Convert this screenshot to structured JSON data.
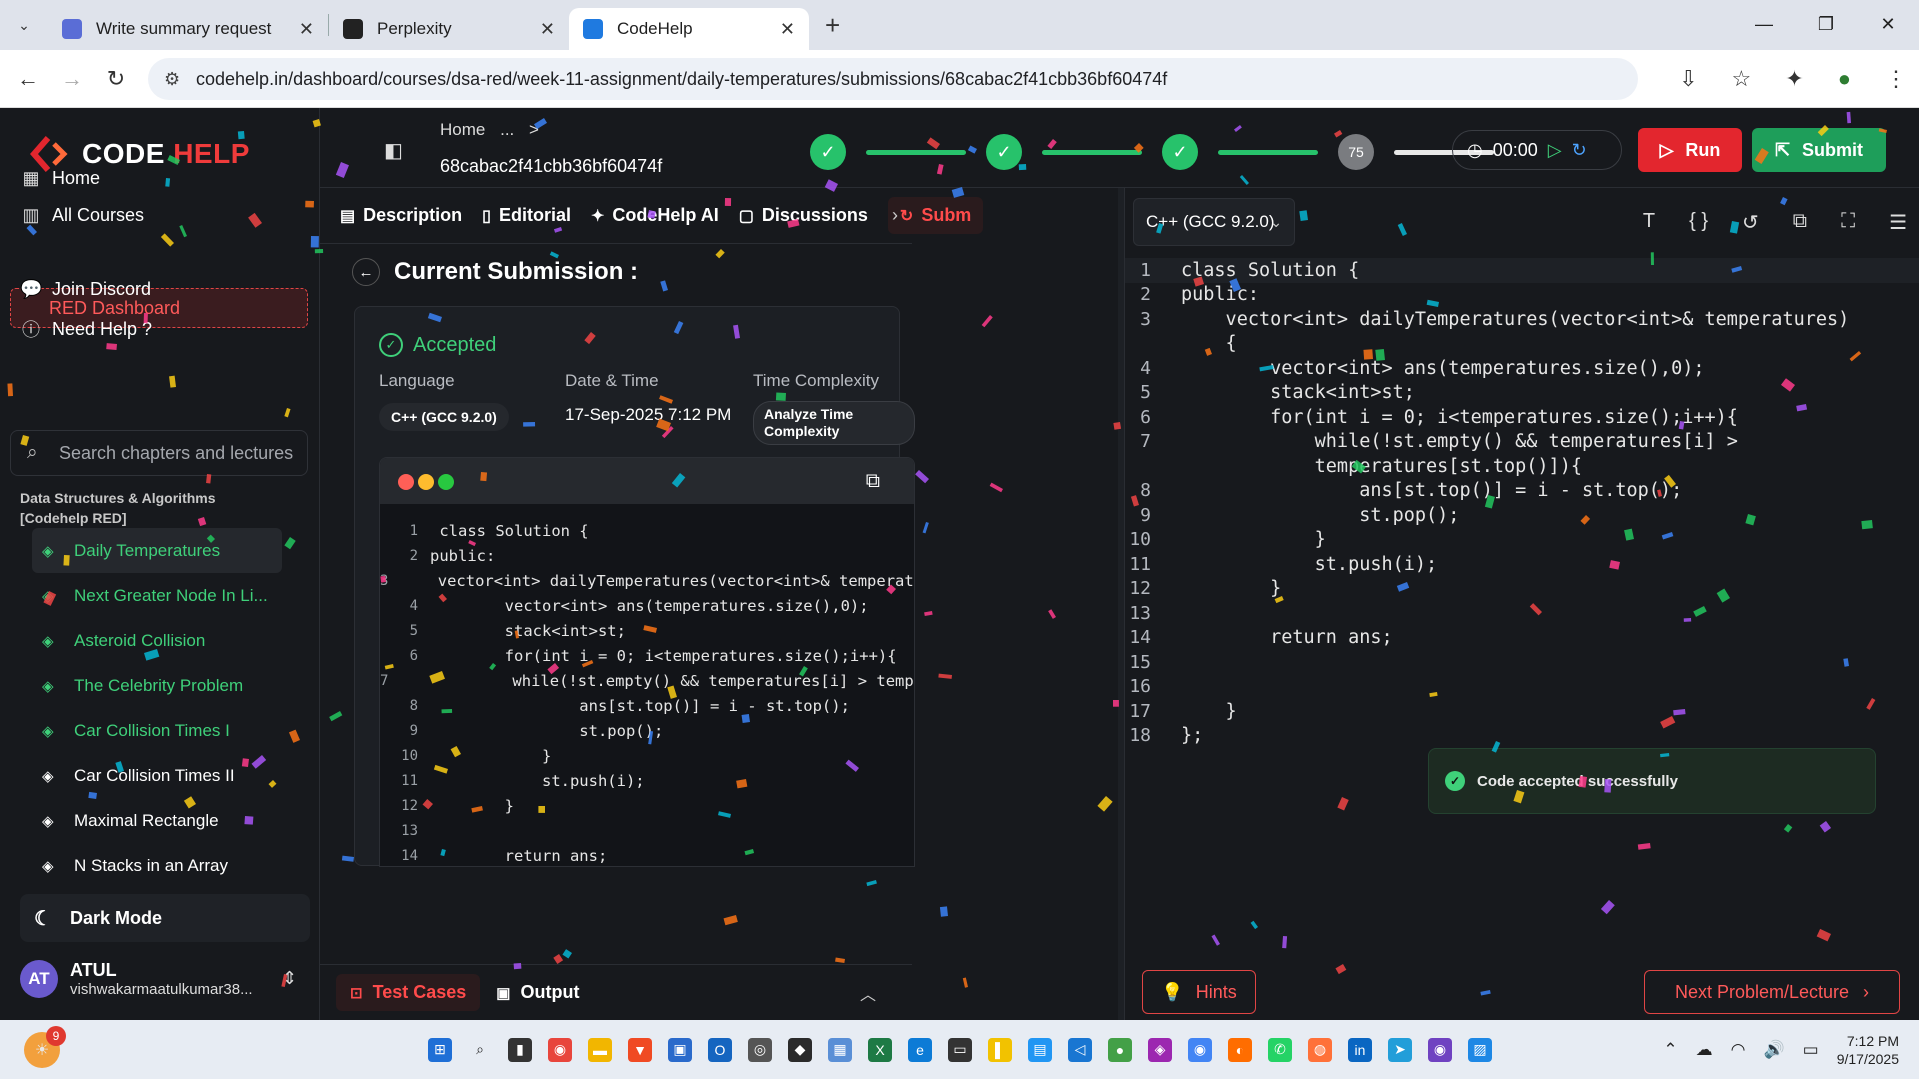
{
  "browser": {
    "tabs": [
      {
        "title": "Write summary request",
        "fav_color": "#5a6dd6"
      },
      {
        "title": "Perplexity",
        "fav_color": "#222222"
      },
      {
        "title": "CodeHelp",
        "fav_color": "#1f7ae0"
      }
    ],
    "url": "codehelp.in/dashboard/courses/dsa-red/week-11-assignment/daily-temperatures/submissions/68cabac2f41cbb36bf60474f"
  },
  "sidebar": {
    "logo_code": "CODE",
    "logo_help": "HELP",
    "nav": [
      {
        "label": "Home",
        "icon": "grid-icon"
      },
      {
        "label": "All Courses",
        "icon": "library-icon"
      },
      {
        "label": "RED Dashboard",
        "icon": "dashboard-icon"
      },
      {
        "label": "Join Discord",
        "icon": "chat-icon"
      },
      {
        "label": "Need Help ?",
        "icon": "help-icon"
      }
    ],
    "search_placeholder": "Search chapters and lectures",
    "course_title": "Data Structures & Algorithms [Codehelp RED]",
    "lessons": [
      {
        "label": "Daily Temperatures",
        "done": true,
        "selected": true
      },
      {
        "label": "Next Greater Node In Li...",
        "done": true
      },
      {
        "label": "Asteroid Collision",
        "done": true
      },
      {
        "label": "The Celebrity Problem",
        "done": true
      },
      {
        "label": "Car Collision Times I",
        "done": true
      },
      {
        "label": "Car Collision Times II",
        "done": false
      },
      {
        "label": "Maximal Rectangle",
        "done": false
      },
      {
        "label": "N Stacks in an Array",
        "done": false
      }
    ],
    "dark_mode_label": "Dark Mode",
    "user": {
      "initials": "AT",
      "name": "ATUL",
      "email": "vishwakarmaatulkumar38..."
    }
  },
  "topbar": {
    "breadcrumb_home": "Home",
    "breadcrumb_more": "...",
    "breadcrumb_sep": ">",
    "submission_id": "68cabac2f41cbb36bf60474f",
    "progress_badge": "75",
    "timer": "00:00",
    "run_label": "Run",
    "submit_label": "Submit"
  },
  "problem_tabs": {
    "tabs": [
      {
        "label": "Description",
        "icon": "doc-icon"
      },
      {
        "label": "Editorial",
        "icon": "book-icon"
      },
      {
        "label": "CodeHelp AI",
        "icon": "sparkle-icon"
      },
      {
        "label": "Discussions",
        "icon": "comment-icon"
      },
      {
        "label": "Subm",
        "icon": "history-icon"
      }
    ]
  },
  "submission": {
    "heading": "Current Submission :",
    "status": "Accepted",
    "language_label": "Language",
    "language_value": "C++ (GCC 9.2.0)",
    "datetime_label": "Date & Time",
    "datetime_value": "17-Sep-2025 7:12 PM",
    "complexity_label": "Time Complexity",
    "complexity_button": "Analyze Time Complexity",
    "code_lines": [
      " class Solution {",
      "public:",
      "    vector<int> dailyTemperatures(vector<int>& temperatures",
      "        vector<int> ans(temperatures.size(),0);",
      "        stack<int>st;",
      "        for(int i = 0; i<temperatures.size();i++){",
      "            while(!st.empty() && temperatures[i] > temperatures",
      "                ans[st.top()] = i - st.top();",
      "                st.pop();",
      "            }",
      "            st.push(i);",
      "        }",
      "",
      "        return ans;"
    ]
  },
  "bottom_tabs": {
    "test_cases": "Test Cases",
    "output": "Output"
  },
  "editor": {
    "language": "C++ (GCC 9.2.0)",
    "lines": [
      {
        "n": "1",
        "t": "class Solution {"
      },
      {
        "n": "2",
        "t": "public:"
      },
      {
        "n": "3",
        "t": "    vector<int> dailyTemperatures(vector<int>& temperatures)"
      },
      {
        "n": "",
        "t": "    {"
      },
      {
        "n": "4",
        "t": "        vector<int> ans(temperatures.size(),0);"
      },
      {
        "n": "5",
        "t": "        stack<int>st;"
      },
      {
        "n": "6",
        "t": "        for(int i = 0; i<temperatures.size();i++){"
      },
      {
        "n": "7",
        "t": "            while(!st.empty() && temperatures[i] >"
      },
      {
        "n": "",
        "t": "            temperatures[st.top()]){"
      },
      {
        "n": "8",
        "t": "                ans[st.top()] = i - st.top();"
      },
      {
        "n": "9",
        "t": "                st.pop();"
      },
      {
        "n": "10",
        "t": "            }"
      },
      {
        "n": "11",
        "t": "            st.push(i);"
      },
      {
        "n": "12",
        "t": "        }"
      },
      {
        "n": "13",
        "t": ""
      },
      {
        "n": "14",
        "t": "        return ans;"
      },
      {
        "n": "15",
        "t": ""
      },
      {
        "n": "16",
        "t": ""
      },
      {
        "n": "17",
        "t": "    }"
      },
      {
        "n": "18",
        "t": "};"
      }
    ]
  },
  "toast": "Code accepted successfully",
  "hints_label": "Hints",
  "next_label": "Next Problem/Lecture",
  "taskbar": {
    "notification_count": "9",
    "time": "7:12 PM",
    "date": "9/17/2025"
  },
  "colors": {
    "accent_red": "#e3262e",
    "accent_green": "#1e9e5a",
    "success": "#3fd07a"
  }
}
